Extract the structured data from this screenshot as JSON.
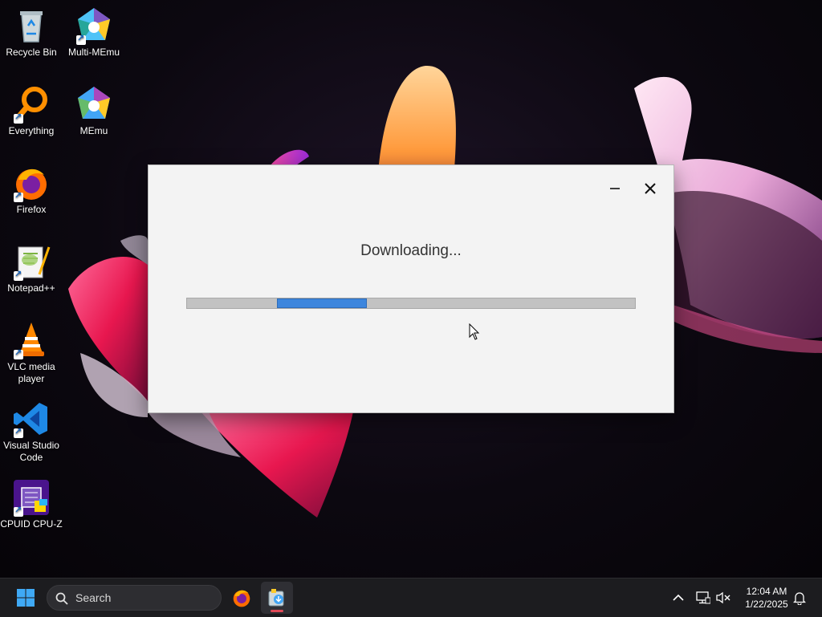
{
  "desktop": {
    "icons": [
      {
        "label": "Recycle Bin",
        "icon": "recycle-bin-icon"
      },
      {
        "label": "Multi-MEmu",
        "icon": "multi-memu-icon"
      },
      {
        "label": "Everything",
        "icon": "everything-icon"
      },
      {
        "label": "MEmu",
        "icon": "memu-icon"
      },
      {
        "label": "Firefox",
        "icon": "firefox-icon"
      },
      {
        "label": "Notepad++",
        "icon": "notepad-plus-plus-icon"
      },
      {
        "label": "VLC media player",
        "icon": "vlc-icon"
      },
      {
        "label": "Visual Studio Code",
        "icon": "vscode-icon"
      },
      {
        "label": "CPUID CPU-Z",
        "icon": "cpuz-icon"
      }
    ]
  },
  "dialog": {
    "status_text": "Downloading...",
    "progress": {
      "indeterminate": true,
      "segment_start": 0.2,
      "segment_end": 0.4
    },
    "colors": {
      "progress_fill": "#3d86dd",
      "progress_track": "#c2c2c2"
    }
  },
  "taskbar": {
    "search_placeholder": "Search",
    "apps": [
      "start-icon",
      "firefox-icon",
      "installer-icon"
    ],
    "active_app": "installer-icon",
    "clock": {
      "time": "12:04 AM",
      "date": "1/22/2025"
    },
    "tray": [
      "chevron-up-icon",
      "network-icon",
      "volume-muted-icon",
      "notification-bell-icon"
    ]
  }
}
